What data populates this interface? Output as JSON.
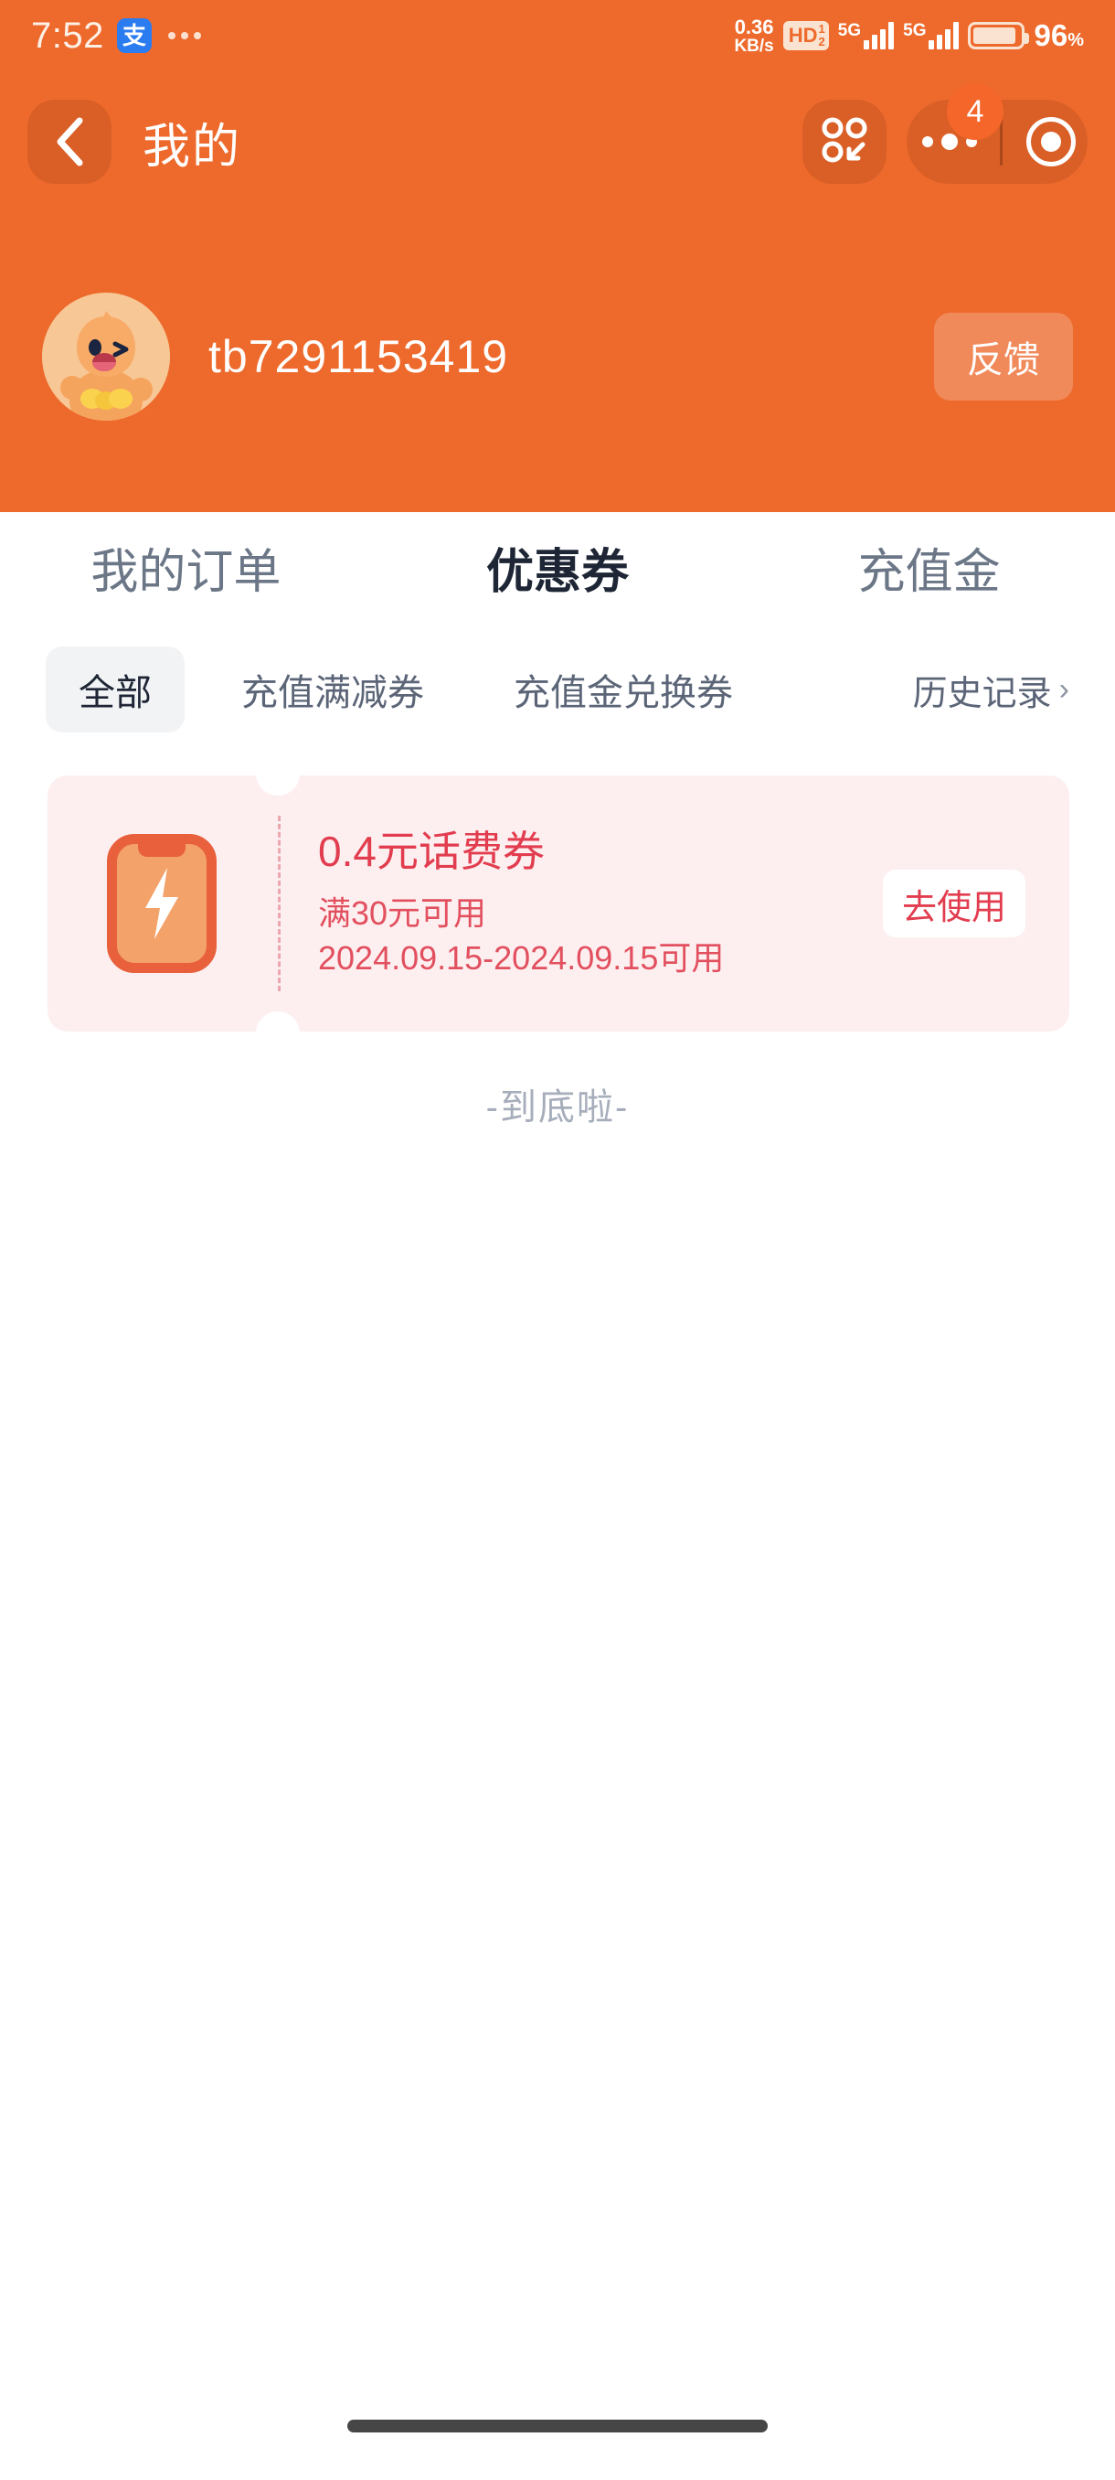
{
  "status_bar": {
    "time": "7:52",
    "app_icon_label": "支",
    "overflow_icon": "more-dots-icon",
    "net_speed_value": "0.36",
    "net_speed_unit": "KB/s",
    "hd_label": "HD",
    "hd_sim_1": "1",
    "hd_sim_2": "2",
    "signal_1_label": "5G",
    "signal_2_label": "5G",
    "battery_percent": "96",
    "battery_percent_symbol": "%"
  },
  "navbar": {
    "back_icon": "chevron-left-icon",
    "title": "我的",
    "mini_share_icon": "mini-program-share-icon",
    "menu_icon": "more-dots-icon",
    "close_icon": "target-circle-icon",
    "badge_count": "4"
  },
  "profile": {
    "avatar_icon": "chick-avatar",
    "username": "tb7291153419",
    "feedback_label": "反馈"
  },
  "main_tabs": [
    {
      "label": "我的订单",
      "active": false
    },
    {
      "label": "优惠券",
      "active": true
    },
    {
      "label": "充值金",
      "active": false
    }
  ],
  "sub_tabs": [
    {
      "label": "全部",
      "active": true
    },
    {
      "label": "充值满减券",
      "active": false
    },
    {
      "label": "充值金兑换券",
      "active": false
    }
  ],
  "history_link": {
    "label": "历史记录",
    "chevron": "›"
  },
  "coupons": [
    {
      "icon": "phone-lightning-icon",
      "title": "0.4元话费券",
      "condition": "满30元可用",
      "validity": "2024.09.15-2024.09.15可用",
      "action_label": "去使用"
    }
  ],
  "list_end_text": "-到底啦-",
  "colors": {
    "header_orange": "#ee6a2c",
    "coupon_bg": "#fdeff0",
    "coupon_red": "#e23d4f",
    "chip_active_bg": "#f2f3f5",
    "text_dark": "#1e2636",
    "text_muted": "#6b7687"
  }
}
